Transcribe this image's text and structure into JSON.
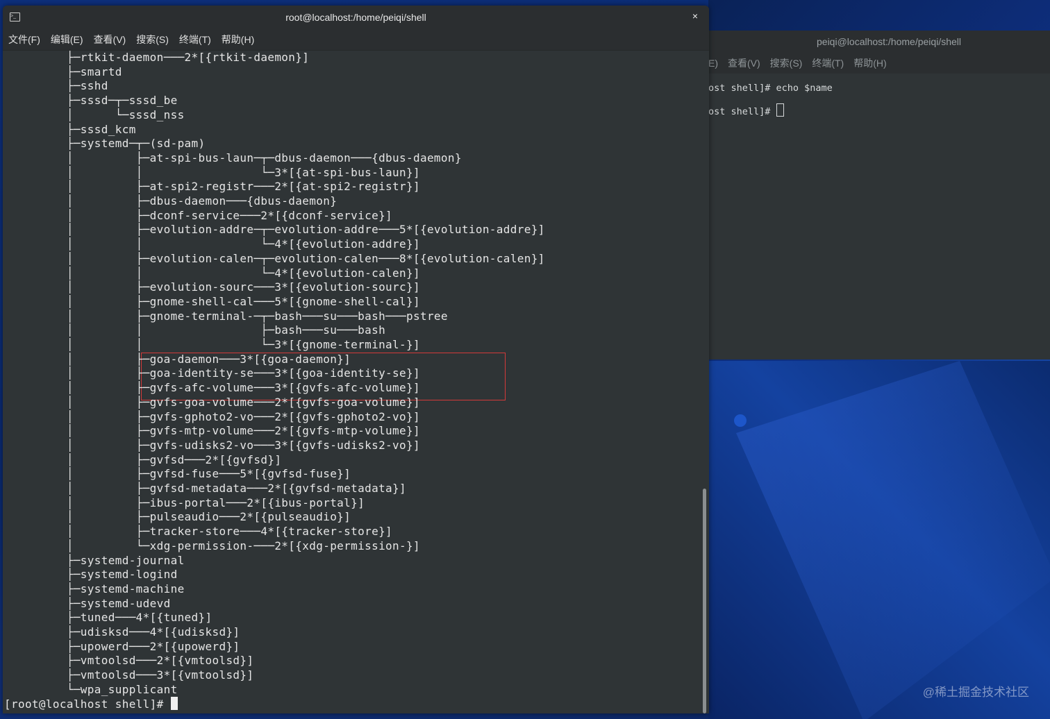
{
  "main_window": {
    "title": "root@localhost:/home/peiqi/shell",
    "close_symbol": "×",
    "menu": [
      "文件(F)",
      "编辑(E)",
      "查看(V)",
      "搜索(S)",
      "终端(T)",
      "帮助(H)"
    ],
    "lines": [
      "         ├─rtkit-daemon───2*[{rtkit-daemon}]",
      "         ├─smartd",
      "         ├─sshd",
      "         ├─sssd─┬─sssd_be",
      "         │      └─sssd_nss",
      "         ├─sssd_kcm",
      "         ├─systemd─┬─(sd-pam)",
      "         │         ├─at-spi-bus-laun─┬─dbus-daemon───{dbus-daemon}",
      "         │         │                 └─3*[{at-spi-bus-laun}]",
      "         │         ├─at-spi2-registr───2*[{at-spi2-registr}]",
      "         │         ├─dbus-daemon───{dbus-daemon}",
      "         │         ├─dconf-service───2*[{dconf-service}]",
      "         │         ├─evolution-addre─┬─evolution-addre───5*[{evolution-addre}]",
      "         │         │                 └─4*[{evolution-addre}]",
      "         │         ├─evolution-calen─┬─evolution-calen───8*[{evolution-calen}]",
      "         │         │                 └─4*[{evolution-calen}]",
      "         │         ├─evolution-sourc───3*[{evolution-sourc}]",
      "         │         ├─gnome-shell-cal───5*[{gnome-shell-cal}]",
      "         │         ├─gnome-terminal-─┬─bash───su───bash───pstree",
      "         │         │                 ├─bash───su───bash",
      "         │         │                 └─3*[{gnome-terminal-}]",
      "         │         ├─goa-daemon───3*[{goa-daemon}]",
      "         │         ├─goa-identity-se───3*[{goa-identity-se}]",
      "         │         ├─gvfs-afc-volume───3*[{gvfs-afc-volume}]",
      "         │         ├─gvfs-goa-volume───2*[{gvfs-goa-volume}]",
      "         │         ├─gvfs-gphoto2-vo───2*[{gvfs-gphoto2-vo}]",
      "         │         ├─gvfs-mtp-volume───2*[{gvfs-mtp-volume}]",
      "         │         ├─gvfs-udisks2-vo───3*[{gvfs-udisks2-vo}]",
      "         │         ├─gvfsd───2*[{gvfsd}]",
      "         │         ├─gvfsd-fuse───5*[{gvfsd-fuse}]",
      "         │         ├─gvfsd-metadata───2*[{gvfsd-metadata}]",
      "         │         ├─ibus-portal───2*[{ibus-portal}]",
      "         │         ├─pulseaudio───2*[{pulseaudio}]",
      "         │         ├─tracker-store───4*[{tracker-store}]",
      "         │         └─xdg-permission-───2*[{xdg-permission-}]",
      "         ├─systemd-journal",
      "         ├─systemd-logind",
      "         ├─systemd-machine",
      "         ├─systemd-udevd",
      "         ├─tuned───4*[{tuned}]",
      "         ├─udisksd───4*[{udisksd}]",
      "         ├─upowerd───2*[{upowerd}]",
      "         ├─vmtoolsd───2*[{vmtoolsd}]",
      "         ├─vmtoolsd───3*[{vmtoolsd}]",
      "         └─wpa_supplicant"
    ],
    "prompt": "[root@localhost shell]# "
  },
  "back_window": {
    "title": "peiqi@localhost:/home/peiqi/shell",
    "menu": [
      "E)",
      "查看(V)",
      "搜索(S)",
      "终端(T)",
      "帮助(H)"
    ],
    "line1": "ost shell]# echo $name",
    "line2": "ost shell]# "
  },
  "watermark": "@稀土掘金技术社区"
}
